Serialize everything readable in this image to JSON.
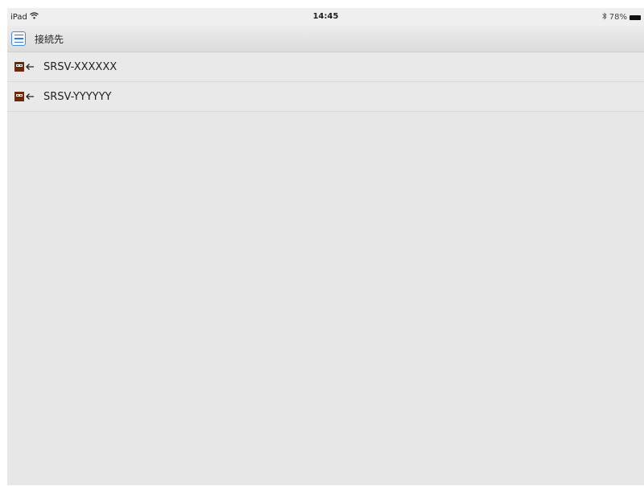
{
  "status_bar": {
    "device": "iPad",
    "time": "14:45",
    "battery": "78%"
  },
  "nav": {
    "title": "接続先"
  },
  "connections": [
    {
      "label": "SRSV-XXXXXX"
    },
    {
      "label": "SRSV-YYYYYY"
    }
  ],
  "colors": {
    "accent": "#3a7ac2",
    "icon": "#6b2a0e",
    "background": "#e7e7e7"
  }
}
